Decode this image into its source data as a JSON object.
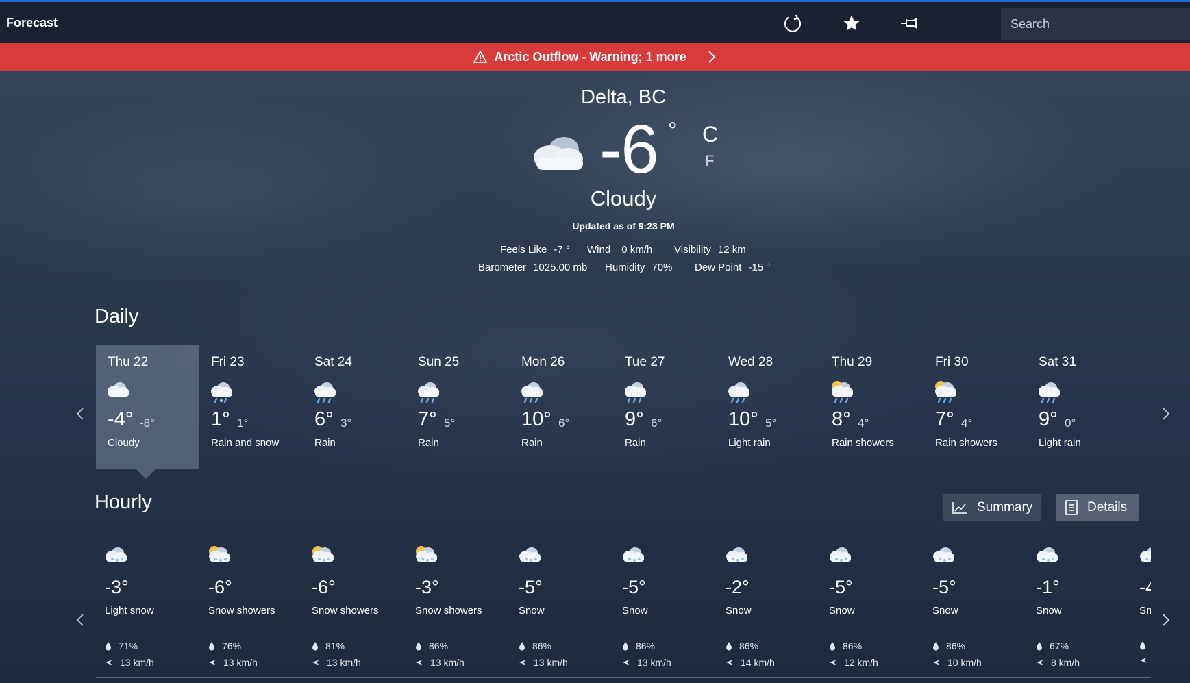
{
  "app": {
    "title": "Forecast"
  },
  "toolbar": {
    "refresh_icon": "refresh-icon",
    "favorite_icon": "star-icon",
    "pin_icon": "pin-icon",
    "theme_icon": "moon-icon"
  },
  "search": {
    "placeholder": "Search"
  },
  "alert": {
    "text": "Arctic Outflow - Warning; 1 more",
    "color": "#d93a3a"
  },
  "current": {
    "location": "Delta, BC",
    "temp": "-6",
    "degree": "°",
    "unit_c": "C",
    "unit_f": "F",
    "condition": "Cloudy",
    "updated": "Updated as of 9:23 PM",
    "feels_like_label": "Feels Like",
    "feels_like": "-7 °",
    "wind_label": "Wind",
    "wind": "0 km/h",
    "visibility_label": "Visibility",
    "visibility": "12 km",
    "barometer_label": "Barometer",
    "barometer": "1025.00 mb",
    "humidity_label": "Humidity",
    "humidity": "70%",
    "dew_point_label": "Dew Point",
    "dew_point": "-15 °"
  },
  "daily": {
    "title": "Daily",
    "days": [
      {
        "name": "Thu 22",
        "hi": "-4°",
        "lo": "-8°",
        "cond": "Cloudy",
        "icon": "cloud-icon"
      },
      {
        "name": "Fri 23",
        "hi": "1°",
        "lo": "1°",
        "cond": "Rain and snow",
        "icon": "rain-snow-icon"
      },
      {
        "name": "Sat 24",
        "hi": "6°",
        "lo": "3°",
        "cond": "Rain",
        "icon": "rain-icon"
      },
      {
        "name": "Sun 25",
        "hi": "7°",
        "lo": "5°",
        "cond": "Rain",
        "icon": "rain-icon"
      },
      {
        "name": "Mon 26",
        "hi": "10°",
        "lo": "6°",
        "cond": "Rain",
        "icon": "rain-icon"
      },
      {
        "name": "Tue 27",
        "hi": "9°",
        "lo": "6°",
        "cond": "Rain",
        "icon": "rain-icon"
      },
      {
        "name": "Wed 28",
        "hi": "10°",
        "lo": "5°",
        "cond": "Light rain",
        "icon": "rain-icon"
      },
      {
        "name": "Thu 29",
        "hi": "8°",
        "lo": "4°",
        "cond": "Rain showers",
        "icon": "sun-rain-icon"
      },
      {
        "name": "Fri 30",
        "hi": "7°",
        "lo": "4°",
        "cond": "Rain showers",
        "icon": "sun-rain-icon"
      },
      {
        "name": "Sat 31",
        "hi": "9°",
        "lo": "0°",
        "cond": "Light rain",
        "icon": "rain-icon"
      }
    ]
  },
  "hourly": {
    "title": "Hourly",
    "summary_label": "Summary",
    "details_label": "Details",
    "hours": [
      {
        "temp": "-3°",
        "cond": "Light snow",
        "humidity": "71%",
        "wind": "13 km/h",
        "icon": "snow-icon"
      },
      {
        "temp": "-6°",
        "cond": "Snow showers",
        "humidity": "76%",
        "wind": "13 km/h",
        "icon": "sun-snow-icon"
      },
      {
        "temp": "-6°",
        "cond": "Snow showers",
        "humidity": "81%",
        "wind": "13 km/h",
        "icon": "sun-snow-icon"
      },
      {
        "temp": "-3°",
        "cond": "Snow showers",
        "humidity": "86%",
        "wind": "13 km/h",
        "icon": "sun-snow-icon"
      },
      {
        "temp": "-5°",
        "cond": "Snow",
        "humidity": "86%",
        "wind": "13 km/h",
        "icon": "snow-icon"
      },
      {
        "temp": "-5°",
        "cond": "Snow",
        "humidity": "86%",
        "wind": "13 km/h",
        "icon": "snow-icon"
      },
      {
        "temp": "-2°",
        "cond": "Snow",
        "humidity": "86%",
        "wind": "14 km/h",
        "icon": "snow-icon"
      },
      {
        "temp": "-5°",
        "cond": "Snow",
        "humidity": "86%",
        "wind": "12 km/h",
        "icon": "snow-icon"
      },
      {
        "temp": "-5°",
        "cond": "Snow",
        "humidity": "86%",
        "wind": "10 km/h",
        "icon": "snow-icon"
      },
      {
        "temp": "-1°",
        "cond": "Snow",
        "humidity": "67%",
        "wind": "8 km/h",
        "icon": "snow-icon"
      },
      {
        "temp": "-4",
        "cond": "Sn",
        "humidity": "",
        "wind": "",
        "icon": "snow-icon"
      }
    ]
  }
}
